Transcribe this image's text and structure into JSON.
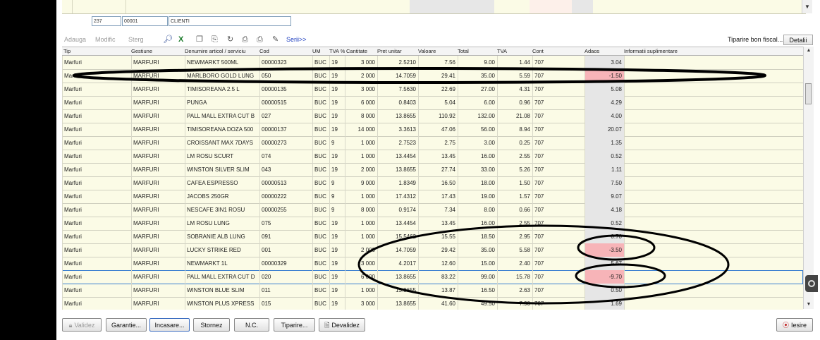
{
  "client": {
    "code": "237",
    "number": "00001",
    "name": "CLIENTI"
  },
  "toolbar": {
    "adauga": "Adauga",
    "modific": "Modific",
    "sterg": "Sterg",
    "serii": "Serii>>",
    "tiparire_bon": "Tiparire bon fiscal...",
    "detalii": "Detalii"
  },
  "columns": [
    "Tip",
    "Gestiune",
    "Denumire articol / serviciu",
    "Cod",
    "UM",
    "TVA %",
    "Cantitate",
    "Pret unitar",
    "Valoare",
    "Total",
    "TVA",
    "Cont",
    "Adaos",
    "Informatii suplimentare"
  ],
  "rows": [
    [
      "Marfuri",
      "MARFURI",
      "NEWMARKT 500ML",
      "00000323",
      "BUC",
      "19",
      "3 000",
      "2.5210",
      "7.56",
      "9.00",
      "1.44",
      "707",
      "3.04"
    ],
    [
      "Marfuri",
      "MARFURI",
      "MARLBORO GOLD LUNG",
      "050",
      "BUC",
      "19",
      "2 000",
      "14.7059",
      "29.41",
      "35.00",
      "5.59",
      "707",
      "-1.50"
    ],
    [
      "Marfuri",
      "MARFURI",
      "TIMISOREANA 2.5 L",
      "00000135",
      "BUC",
      "19",
      "3 000",
      "7.5630",
      "22.69",
      "27.00",
      "4.31",
      "707",
      "5.08"
    ],
    [
      "Marfuri",
      "MARFURI",
      "PUNGA",
      "00000515",
      "BUC",
      "19",
      "6 000",
      "0.8403",
      "5.04",
      "6.00",
      "0.96",
      "707",
      "4.29"
    ],
    [
      "Marfuri",
      "MARFURI",
      "PALL MALL EXTRA CUT B",
      "027",
      "BUC",
      "19",
      "8 000",
      "13.8655",
      "110.92",
      "132.00",
      "21.08",
      "707",
      "4.00"
    ],
    [
      "Marfuri",
      "MARFURI",
      "TIMISOREANA DOZA 500",
      "00000137",
      "BUC",
      "19",
      "14 000",
      "3.3613",
      "47.06",
      "56.00",
      "8.94",
      "707",
      "20.07"
    ],
    [
      "Marfuri",
      "MARFURI",
      "CROISSANT MAX 7DAYS",
      "00000273",
      "BUC",
      "9",
      "1 000",
      "2.7523",
      "2.75",
      "3.00",
      "0.25",
      "707",
      "1.35"
    ],
    [
      "Marfuri",
      "MARFURI",
      "LM ROSU SCURT",
      "074",
      "BUC",
      "19",
      "1 000",
      "13.4454",
      "13.45",
      "16.00",
      "2.55",
      "707",
      "0.52"
    ],
    [
      "Marfuri",
      "MARFURI",
      "WINSTON SILVER SLIM",
      "043",
      "BUC",
      "19",
      "2 000",
      "13.8655",
      "27.74",
      "33.00",
      "5.26",
      "707",
      "1.11"
    ],
    [
      "Marfuri",
      "MARFURI",
      "CAFEA ESPRESSO",
      "00000513",
      "BUC",
      "9",
      "9 000",
      "1.8349",
      "16.50",
      "18.00",
      "1.50",
      "707",
      "7.50"
    ],
    [
      "Marfuri",
      "MARFURI",
      "JACOBS 250GR",
      "00000222",
      "BUC",
      "9",
      "1 000",
      "17.4312",
      "17.43",
      "19.00",
      "1.57",
      "707",
      "9.07"
    ],
    [
      "Marfuri",
      "MARFURI",
      "NESCAFE 3IN1 ROSU",
      "00000255",
      "BUC",
      "9",
      "8 000",
      "0.9174",
      "7.34",
      "8.00",
      "0.66",
      "707",
      "4.18"
    ],
    [
      "Marfuri",
      "MARFURI",
      "LM ROSU LUNG",
      "075",
      "BUC",
      "19",
      "1 000",
      "13.4454",
      "13.45",
      "16.00",
      "2.55",
      "707",
      "0.52"
    ],
    [
      "Marfuri",
      "MARFURI",
      "SOBRANIE ALB LUNG",
      "091",
      "BUC",
      "19",
      "1 000",
      "15.5462",
      "15.55",
      "18.50",
      "2.95",
      "707",
      "0.70"
    ],
    [
      "Marfuri",
      "MARFURI",
      "LUCKY STRIKE RED",
      "001",
      "BUC",
      "19",
      "2 000",
      "14.7059",
      "29.42",
      "35.00",
      "5.58",
      "707",
      "-3.50"
    ],
    [
      "Marfuri",
      "MARFURI",
      "NEWMARKT 1L",
      "00000329",
      "BUC",
      "19",
      "3 000",
      "4.2017",
      "12.60",
      "15.00",
      "2.40",
      "707",
      "5.67"
    ],
    [
      "Marfuri",
      "MARFURI",
      "PALL MALL EXTRA CUT D",
      "020",
      "BUC",
      "19",
      "6 000",
      "13.8655",
      "83.22",
      "99.00",
      "15.78",
      "707",
      "-9.70"
    ],
    [
      "Marfuri",
      "MARFURI",
      "WINSTON BLUE SLIM",
      "011",
      "BUC",
      "19",
      "1 000",
      "13.8655",
      "13.87",
      "16.50",
      "2.63",
      "707",
      "0.50"
    ],
    [
      "Marfuri",
      "MARFURI",
      "WINSTON PLUS XPRESS",
      "015",
      "BUC",
      "19",
      "3 000",
      "13.8655",
      "41.60",
      "49.50",
      "7.90",
      "707",
      "1.69"
    ]
  ],
  "selected_row": 16,
  "buttons": {
    "validez": "Validez",
    "garantie": "Garantie...",
    "incasare": "Incasare...",
    "stornez": "Stornez",
    "nc": "N.C.",
    "tiparire": "Tiparire...",
    "devalidez": "Devalidez",
    "iesire": "Iesire"
  },
  "colors": {
    "grid_bg": "#fbfbe6",
    "negative_adaos": "#f7b4b8",
    "adaos_col": "#e6e6e6",
    "selection": "#3a7fd0"
  }
}
